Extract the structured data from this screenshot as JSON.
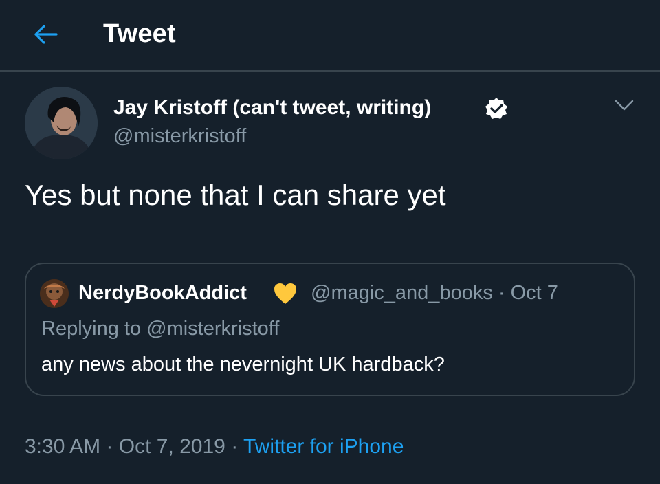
{
  "header": {
    "back_icon": "arrow-left-icon",
    "title": "Tweet"
  },
  "tweet": {
    "author": {
      "display_name": "Jay Kristoff (can't tweet, writing)",
      "handle": "@misterkristoff",
      "verified_icon": "verified-badge-icon"
    },
    "menu_icon": "chevron-down-icon",
    "text": "Yes but none that I can share yet",
    "quoted": {
      "display_name": "NerdyBookAddict",
      "emoji": "yellow-heart-icon",
      "handle_and_date": "@magic_and_books · Oct 7",
      "replying_to": "Replying to @misterkristoff",
      "text": "any news about the nevernight UK hardback?"
    },
    "time": "3:30 AM",
    "separator": " · ",
    "date": "Oct 7, 2019",
    "client": "Twitter for iPhone"
  },
  "colors": {
    "background": "#15202b",
    "border": "#38444d",
    "secondary_text": "#8899a6",
    "accent": "#1da1f2",
    "heart": "#ffc83d"
  }
}
